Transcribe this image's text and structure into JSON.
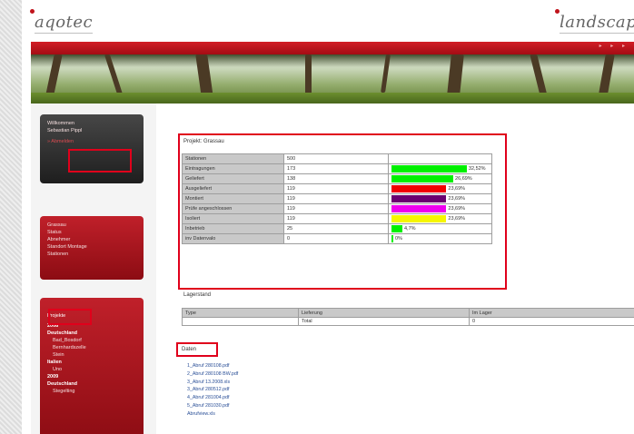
{
  "header": {
    "logo_left": "aqotec",
    "logo_right": "landscape",
    "redbar_marks": "▸ ▸ ▸"
  },
  "sidebar": {
    "user_box": {
      "items": [
        "Willkommen",
        "Sebastian Pippl",
        "» Abmelden"
      ]
    },
    "menu_box": {
      "items": [
        "Grassau",
        "Status",
        "Abnehmer",
        "Standort Montage",
        "Stationen"
      ]
    },
    "project_box": {
      "header": "Projekte",
      "items": [
        {
          "label": "2008",
          "bold": true,
          "level": 0
        },
        {
          "label": "Deutschland",
          "bold": true,
          "level": 0
        },
        {
          "label": "Bad_Bosdorf",
          "bold": false,
          "level": 1
        },
        {
          "label": "Bernhardszelle",
          "bold": false,
          "level": 1
        },
        {
          "label": "Stein",
          "bold": false,
          "level": 1
        },
        {
          "label": "Italien",
          "bold": true,
          "level": 0
        },
        {
          "label": "Uno",
          "bold": false,
          "level": 1
        },
        {
          "label": "2009",
          "bold": true,
          "level": 0
        },
        {
          "label": "Deutschland",
          "bold": true,
          "level": 0
        },
        {
          "label": "Stegelting",
          "bold": false,
          "level": 1
        }
      ]
    }
  },
  "main": {
    "stats_title": "Projekt: Grassau",
    "stats": [
      {
        "label": "Stationen",
        "value": "500",
        "percent": null,
        "percent_text": "",
        "color": ""
      },
      {
        "label": "Eintragungen",
        "value": "173",
        "percent": 32.52,
        "percent_text": "32,52%",
        "color": "#00f000"
      },
      {
        "label": "Geliefert",
        "value": "138",
        "percent": 26.69,
        "percent_text": "26,69%",
        "color": "#00f000"
      },
      {
        "label": "Ausgeliefert",
        "value": "119",
        "percent": 23.69,
        "percent_text": "23,69%",
        "color": "#f00000"
      },
      {
        "label": "Montiert",
        "value": "119",
        "percent": 23.69,
        "percent_text": "23,69%",
        "color": "#6a0070"
      },
      {
        "label": "Prüfe angeschlossen",
        "value": "119",
        "percent": 23.69,
        "percent_text": "23,69%",
        "color": "#ee00ee"
      },
      {
        "label": "Isoliert",
        "value": "119",
        "percent": 23.69,
        "percent_text": "23,69%",
        "color": "#f6f600"
      },
      {
        "label": "Inbetrieb",
        "value": "25",
        "percent": 4.7,
        "percent_text": "4,7%",
        "color": "#00f000"
      },
      {
        "label": "inv Datenvalo",
        "value": "0",
        "percent": 0,
        "percent_text": "0%",
        "color": "#00f000"
      }
    ],
    "lager_title": "Lagerstand",
    "lager_headers": [
      "Type",
      "Lieferung",
      "Im Lager"
    ],
    "lager_rows": [
      [
        "",
        "Total",
        "0"
      ]
    ],
    "files_title": "Daten",
    "files": [
      "1_Abruf 280108.pdf",
      "2_Abruf 280108 BW.pdf",
      "3_Abruf 13.2008.xls",
      "3_Abruf 280512.pdf",
      "4_Abruf 281004.pdf",
      "5_Abruf 281030.pdf",
      "Abrufview.xls"
    ]
  }
}
